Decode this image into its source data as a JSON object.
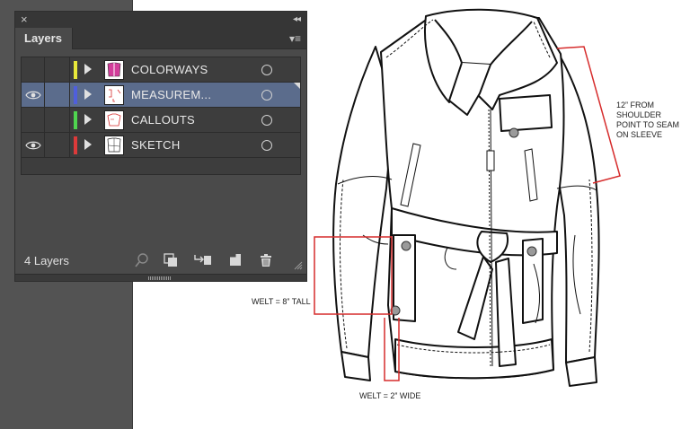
{
  "panel": {
    "close_glyph": "×",
    "collapse_glyph": "◂◂",
    "tab_label": "Layers",
    "menu_glyph": "▾≡",
    "footer_count": "4 Layers",
    "colors": {
      "background": "#4a4a4a",
      "selection": "#5b6c8c"
    },
    "footer_icons": [
      "locate-object-icon",
      "make-clipping-mask-icon",
      "create-sublayer-icon",
      "create-new-layer-icon",
      "delete-layer-icon"
    ]
  },
  "layers": [
    {
      "name": "COLORWAYS",
      "visible": false,
      "selected": false,
      "color": "#e8e83a",
      "thumb": "colorways-thumb-icon"
    },
    {
      "name": "MEASUREM...",
      "visible": true,
      "selected": true,
      "color": "#4f5fdc",
      "thumb": "measurements-thumb-icon"
    },
    {
      "name": "CALLOUTS",
      "visible": false,
      "selected": false,
      "color": "#4fd44f",
      "thumb": "callouts-thumb-icon"
    },
    {
      "name": "SKETCH",
      "visible": true,
      "selected": false,
      "color": "#dd3a3a",
      "thumb": "sketch-thumb-icon"
    }
  ],
  "annotations": {
    "shoulder": [
      "12” FROM",
      "SHOULDER",
      "POINT TO SEAM",
      "ON SLEEVE"
    ],
    "welt_tall": "WELT = 8” TALL",
    "welt_wide": "WELT = 2” WIDE",
    "line_color": "#d62c2c"
  }
}
